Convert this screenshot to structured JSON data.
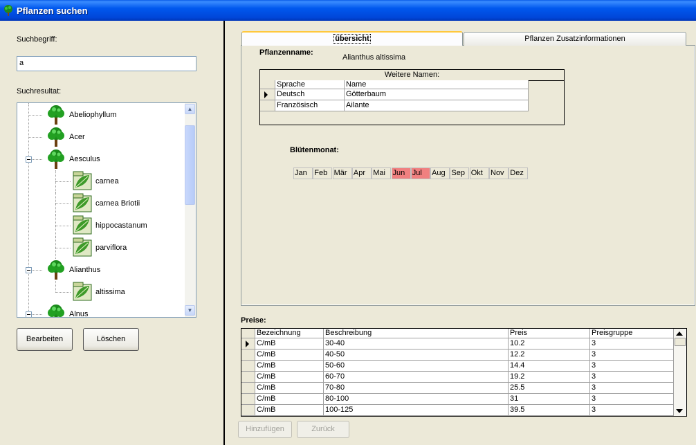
{
  "window": {
    "title": "Pflanzen suchen"
  },
  "search": {
    "label": "Suchbegriff:",
    "value": "a",
    "result_label": "Suchresultat:"
  },
  "tree": {
    "items": [
      {
        "label": "Abeliophyllum",
        "level": 0,
        "expander": false,
        "icon": "tree-icon"
      },
      {
        "label": "Acer",
        "level": 0,
        "expander": false,
        "icon": "tree-icon"
      },
      {
        "label": "Aesculus",
        "level": 0,
        "expander": true,
        "icon": "tree-icon"
      },
      {
        "label": "carnea",
        "level": 1,
        "expander": false,
        "icon": "leaf-image-icon"
      },
      {
        "label": "carnea Briotii",
        "level": 1,
        "expander": false,
        "icon": "leaf-image-icon"
      },
      {
        "label": "hippocastanum",
        "level": 1,
        "expander": false,
        "icon": "leaf-image-icon"
      },
      {
        "label": "parviflora",
        "level": 1,
        "expander": false,
        "icon": "leaf-image-icon"
      },
      {
        "label": "Alianthus",
        "level": 0,
        "expander": true,
        "icon": "tree-icon"
      },
      {
        "label": "altissima",
        "level": 1,
        "expander": false,
        "icon": "leaf-image-icon"
      },
      {
        "label": "Alnus",
        "level": 0,
        "expander": true,
        "icon": "tree-icon"
      }
    ]
  },
  "buttons": {
    "edit": "Bearbeiten",
    "delete": "Löschen",
    "add": "Hinzufügen",
    "back": "Zurück"
  },
  "tabs": [
    {
      "label": "übersicht",
      "active": true
    },
    {
      "label": "Pflanzen Zusatzinformationen",
      "active": false
    }
  ],
  "overview": {
    "plant_name_label": "Pflanzenname:",
    "plant_name": "Alianthus altissima",
    "other_names": {
      "caption": "Weitere Namen:",
      "headers": [
        "Sprache",
        "Name"
      ],
      "rows": [
        [
          "Deutsch",
          "Götterbaum"
        ],
        [
          "Französisch",
          "Ailante"
        ]
      ]
    },
    "bloom_label": "Blütenmonat:",
    "months": [
      {
        "label": "Jan",
        "bloom": false
      },
      {
        "label": "Feb",
        "bloom": false
      },
      {
        "label": "Mär",
        "bloom": false
      },
      {
        "label": "Apr",
        "bloom": false
      },
      {
        "label": "Mai",
        "bloom": false
      },
      {
        "label": "Jun",
        "bloom": true
      },
      {
        "label": "Jul",
        "bloom": true
      },
      {
        "label": "Aug",
        "bloom": false
      },
      {
        "label": "Sep",
        "bloom": false
      },
      {
        "label": "Okt",
        "bloom": false
      },
      {
        "label": "Nov",
        "bloom": false
      },
      {
        "label": "Dez",
        "bloom": false
      }
    ],
    "bloom_color": "#f08080"
  },
  "prices": {
    "label": "Preise:",
    "headers": [
      "Bezeichnung",
      "Beschreibung",
      "Preis",
      "Preisgruppe"
    ],
    "rows": [
      [
        "C/mB",
        "30-40",
        "10.2",
        "3"
      ],
      [
        "C/mB",
        "40-50",
        "12.2",
        "3"
      ],
      [
        "C/mB",
        "50-60",
        "14.4",
        "3"
      ],
      [
        "C/mB",
        "60-70",
        "19.2",
        "3"
      ],
      [
        "C/mB",
        "70-80",
        "25.5",
        "3"
      ],
      [
        "C/mB",
        "80-100",
        "31",
        "3"
      ],
      [
        "C/mB",
        "100-125",
        "39.5",
        "3"
      ]
    ]
  },
  "colors": {
    "titlebar": "#0054e3",
    "window_bg": "#ece9d8"
  }
}
